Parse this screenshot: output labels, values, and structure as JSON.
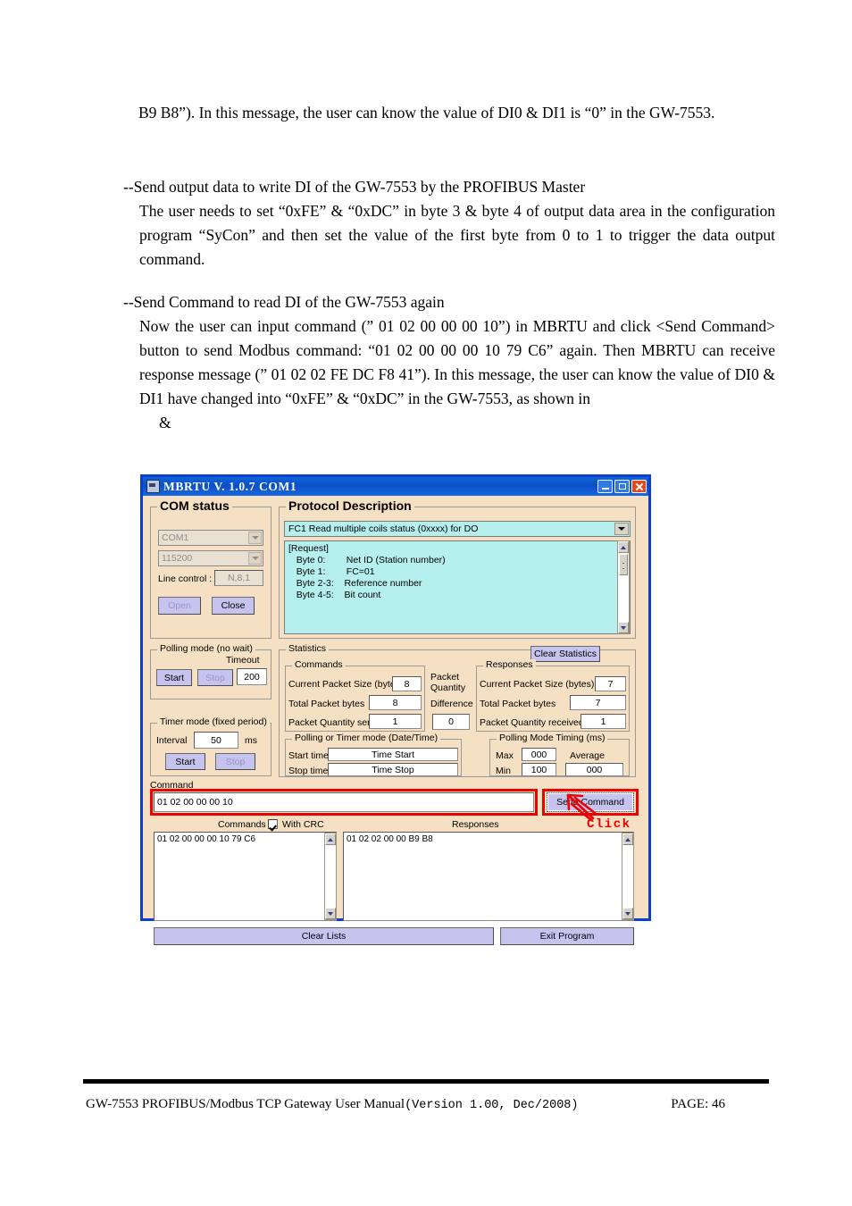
{
  "document": {
    "paragraphs": {
      "p1": "B9 B8”). In this message, the user can know the value of DI0 & DI1 is “0” in the GW-7553.",
      "p2_heading": "--Send output data to write DI of the GW-7553 by the PROFIBUS Master",
      "p2_body": "The user needs to set “0xFE” & “0xDC” in byte 3 & byte 4 of output data area in the configuration program “SyCon” and then set the value of the first byte from 0 to 1 to trigger the data output command.",
      "p3_heading": "--Send Command to read DI of the GW-7553 again",
      "p3_body": "Now the user can input command (” 01 02 00 00 00 10”) in MBRTU and click <Send Command> button to send Modbus command: “01 02 00 00 00 10 79 C6” again. Then MBRTU can receive response message (” 01 02 02 FE DC F8 41”). In this message, the user can know the value of DI0 & DI1 have changed into “0xFE” & “0xDC” in the GW-7553, as shown in",
      "p3_tail": "&"
    },
    "footer": {
      "manual_title": "GW-7553 PROFIBUS/Modbus TCP Gateway User Manual ",
      "version": "(Version 1.00, Dec/2008)",
      "page": "PAGE: 46"
    }
  },
  "annotation": {
    "click_label": "Click",
    "color": "#ee0000"
  },
  "app": {
    "title": "MBRTU V. 1.0.7 COM1",
    "window_buttons": {
      "minimize": "minimize",
      "maximize": "maximize",
      "close": "close"
    },
    "com_status": {
      "legend": "COM status",
      "port": "COM1",
      "baud": "115200",
      "line_control_label": "Line control :",
      "line_control_value": "N,8,1",
      "open_button": "Open",
      "close_button": "Close"
    },
    "protocol": {
      "legend": "Protocol Description",
      "selected": "FC1  Read multiple coils status (0xxxx)  for DO",
      "description_lines": [
        "[Request]",
        "   Byte 0:        Net ID (Station number)",
        "   Byte 1:        FC=01",
        "   Byte 2-3:    Reference number",
        "   Byte 4-5:    Bit count"
      ]
    },
    "polling_mode": {
      "legend": "Polling mode (no wait)",
      "start_button": "Start",
      "stop_button": "Stop",
      "timeout_label": "Timeout",
      "timeout_value": "200"
    },
    "timer_mode": {
      "legend": "Timer mode (fixed period)",
      "interval_label": "Interval",
      "interval_value": "50",
      "unit": "ms",
      "start_button": "Start",
      "stop_button": "Stop"
    },
    "statistics": {
      "legend": "Statistics",
      "clear_button": "Clear Statistics",
      "commands": {
        "legend": "Commands",
        "current_packet_size_label": "Current Packet Size (bytes)",
        "current_packet_size_value": "8",
        "total_packet_bytes_label": "Total Packet bytes",
        "total_packet_bytes_value": "8",
        "packet_quantity_sent_label": "Packet Quantity sent",
        "packet_quantity_sent_value": "1"
      },
      "difference": {
        "label_line1": "Packet",
        "label_line2": "Quantity",
        "label_line3": "Difference",
        "value": "0"
      },
      "responses": {
        "legend": "Responses",
        "current_packet_size_label": "Current Packet Size (bytes)",
        "current_packet_size_value": "7",
        "total_packet_bytes_label": "Total Packet bytes",
        "total_packet_bytes_value": "7",
        "packet_quantity_received_label": "Packet Quantity received",
        "packet_quantity_received_value": "1"
      },
      "datetime": {
        "legend": "Polling  or Timer mode  (Date/Time)",
        "start_label": "Start time",
        "start_value": "Time Start",
        "stop_label": "Stop time",
        "stop_value": "Time Stop"
      },
      "timing": {
        "legend": "Polling Mode Timing (ms)",
        "max_label": "Max",
        "max_value": "000",
        "min_label": "Min",
        "min_value": "100",
        "average_label": "Average",
        "average_value": "000"
      }
    },
    "command": {
      "label": "Command",
      "input_value": "01 02 00 00 00 10",
      "send_button": "Send Command"
    },
    "lists": {
      "commands_label": "Commands",
      "with_crc_label": "With CRC",
      "responses_label": "Responses",
      "commands_items": [
        "01 02 00 00 00 10 79 C6"
      ],
      "responses_items": [
        "01 02 02 00 00 B9 B8"
      ]
    },
    "bottom_buttons": {
      "clear_lists": "Clear Lists",
      "exit_program": "Exit Program"
    },
    "colors": {
      "window_border": "#0a3fd0",
      "panel_bg": "#f6e0c3",
      "button_bg": "#c6c4ef",
      "protocol_bg": "#b6f0ee",
      "highlight": "#ee0000"
    }
  }
}
